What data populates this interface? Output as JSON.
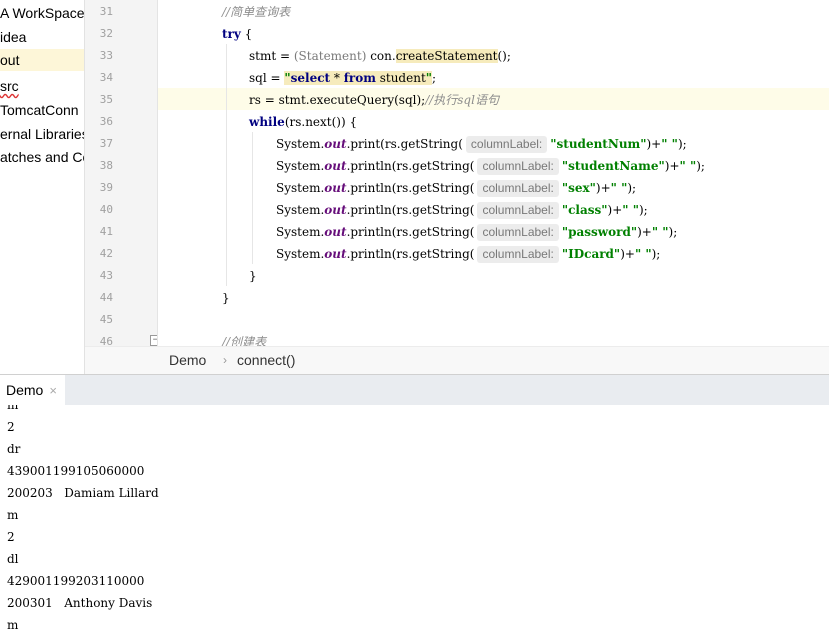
{
  "project_tree": {
    "items": [
      {
        "label": "A WorkSpace"
      },
      {
        "label": "idea"
      },
      {
        "label": "out"
      },
      {
        "label": "src"
      },
      {
        "label": "TomcatConn"
      },
      {
        "label": "ernal Libraries"
      },
      {
        "label": "atches and Co"
      }
    ]
  },
  "editor": {
    "line_numbers": [
      "31",
      "32",
      "33",
      "34",
      "35",
      "36",
      "37",
      "38",
      "39",
      "40",
      "41",
      "42",
      "43",
      "44",
      "45",
      "46"
    ],
    "current_line": "35",
    "code": {
      "l31_comment": "//简单查询表",
      "l32_try": "try",
      "l32_brace": " {",
      "l33_a": "stmt = ",
      "l33_cast": "(Statement)",
      "l33_b": " con.",
      "l33_method": "createStatement",
      "l33_c": "();",
      "l34_a": "sql = ",
      "l34_str_a": "\"",
      "l34_kw_select": "select",
      "l34_star": " * ",
      "l34_kw_from": "from",
      "l34_table": " student",
      "l34_str_b": "\"",
      "l34_end": ";",
      "l35_a": "rs = stmt.executeQuery(sql);",
      "l35_comment": "//执行sql语句",
      "l36_kw": "while",
      "l36_rest": "(rs.next()) {",
      "sys": "System.",
      "out": "out",
      "print": ".print(rs.getString(",
      "println": ".println(rs.getString(",
      "hint_label": "columnLabel:",
      "arg_studentNum": "\"studentNum\"",
      "arg_studentName": "\"studentName\"",
      "arg_sex": "\"sex\"",
      "arg_class": "\"class\"",
      "arg_password": "\"password\"",
      "arg_IDcard": "\"IDcard\"",
      "concat": ")+",
      "tail_str": "\"   \"",
      "tail_end": ");",
      "close_brace": "}",
      "l46_comment": "//创建表"
    }
  },
  "breadcrumb": {
    "items": [
      "Demo",
      "connect()"
    ],
    "separator": "›"
  },
  "run_panel": {
    "tab_label": "Demo",
    "close_glyph": "×",
    "output_lines": [
      "m",
      "2",
      "dr",
      "439001199105060000",
      "200203   Damiam Lillard",
      "m",
      "2",
      "dl",
      "429001199203110000",
      "200301   Anthony Davis",
      "m"
    ]
  },
  "colors": {
    "keyword": "#000080",
    "string": "#008000",
    "field": "#660e7a",
    "comment": "#8c8c8c",
    "current_line": "#fefce8",
    "usage_highlight": "#f6ebbc"
  }
}
